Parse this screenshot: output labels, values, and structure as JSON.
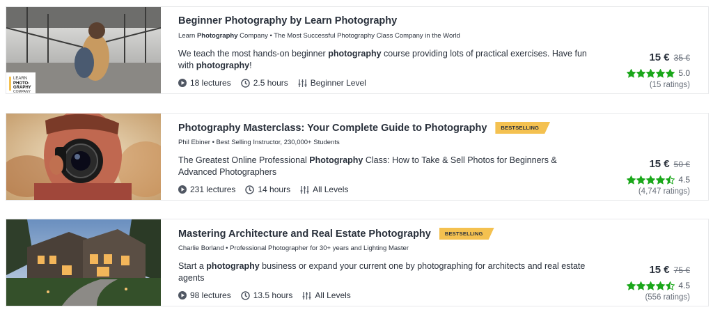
{
  "courses": [
    {
      "title": "Beginner Photography by Learn Photography",
      "badge": "",
      "meta_pre": "Learn ",
      "meta_bold": "Photography",
      "meta_post": " Company • The Most Successful Photography Class Company in the World",
      "desc_parts": [
        {
          "t": "We teach the most hands-on beginner ",
          "b": false
        },
        {
          "t": "photography",
          "b": true
        },
        {
          "t": " course providing lots of practical exercises. Have fun with ",
          "b": false
        },
        {
          "t": "photography",
          "b": true
        },
        {
          "t": "!",
          "b": false
        }
      ],
      "lectures": "18 lectures",
      "hours": "2.5 hours",
      "level": "Beginner Level",
      "price": "15 €",
      "old_price": "35 €",
      "rating": "5.0",
      "rating_value": 5.0,
      "ratings_count": "(15 ratings)",
      "thumb_label": "LEARN PHOTO-GRAPHY COMPANY"
    },
    {
      "title": "Photography Masterclass: Your Complete Guide to Photography",
      "badge": "BESTSELLING",
      "meta_pre": "Phil Ebiner • Best Selling Instructor, 230,000+ Students",
      "meta_bold": "",
      "meta_post": "",
      "desc_parts": [
        {
          "t": "The Greatest Online Professional ",
          "b": false
        },
        {
          "t": "Photography",
          "b": true
        },
        {
          "t": " Class: How to Take & Sell Photos for Beginners & Advanced Photographers",
          "b": false
        }
      ],
      "lectures": "231 lectures",
      "hours": "14 hours",
      "level": "All Levels",
      "price": "15 €",
      "old_price": "50 €",
      "rating": "4.5",
      "rating_value": 4.5,
      "ratings_count": "(4,747 ratings)"
    },
    {
      "title": "Mastering Architecture and Real Estate Photography",
      "badge": "BESTSELLING",
      "meta_pre": "Charlie Borland • Professional Photographer for 30+ years and Lighting Master",
      "meta_bold": "",
      "meta_post": "",
      "desc_parts": [
        {
          "t": "Start a ",
          "b": false
        },
        {
          "t": "photography",
          "b": true
        },
        {
          "t": " business or expand your current one by photographing for architects and real estate agents",
          "b": false
        }
      ],
      "lectures": "98 lectures",
      "hours": "13.5 hours",
      "level": "All Levels",
      "price": "15 €",
      "old_price": "75 €",
      "rating": "4.5",
      "rating_value": 4.5,
      "ratings_count": "(556 ratings)"
    }
  ],
  "icons": {
    "lectures": "play-circle-icon",
    "hours": "clock-icon",
    "level": "level-sliders-icon",
    "star": "star-icon"
  },
  "colors": {
    "star": "#1aa71a",
    "badge": "#f4c150",
    "text": "#29303b",
    "muted": "#686f7a"
  }
}
